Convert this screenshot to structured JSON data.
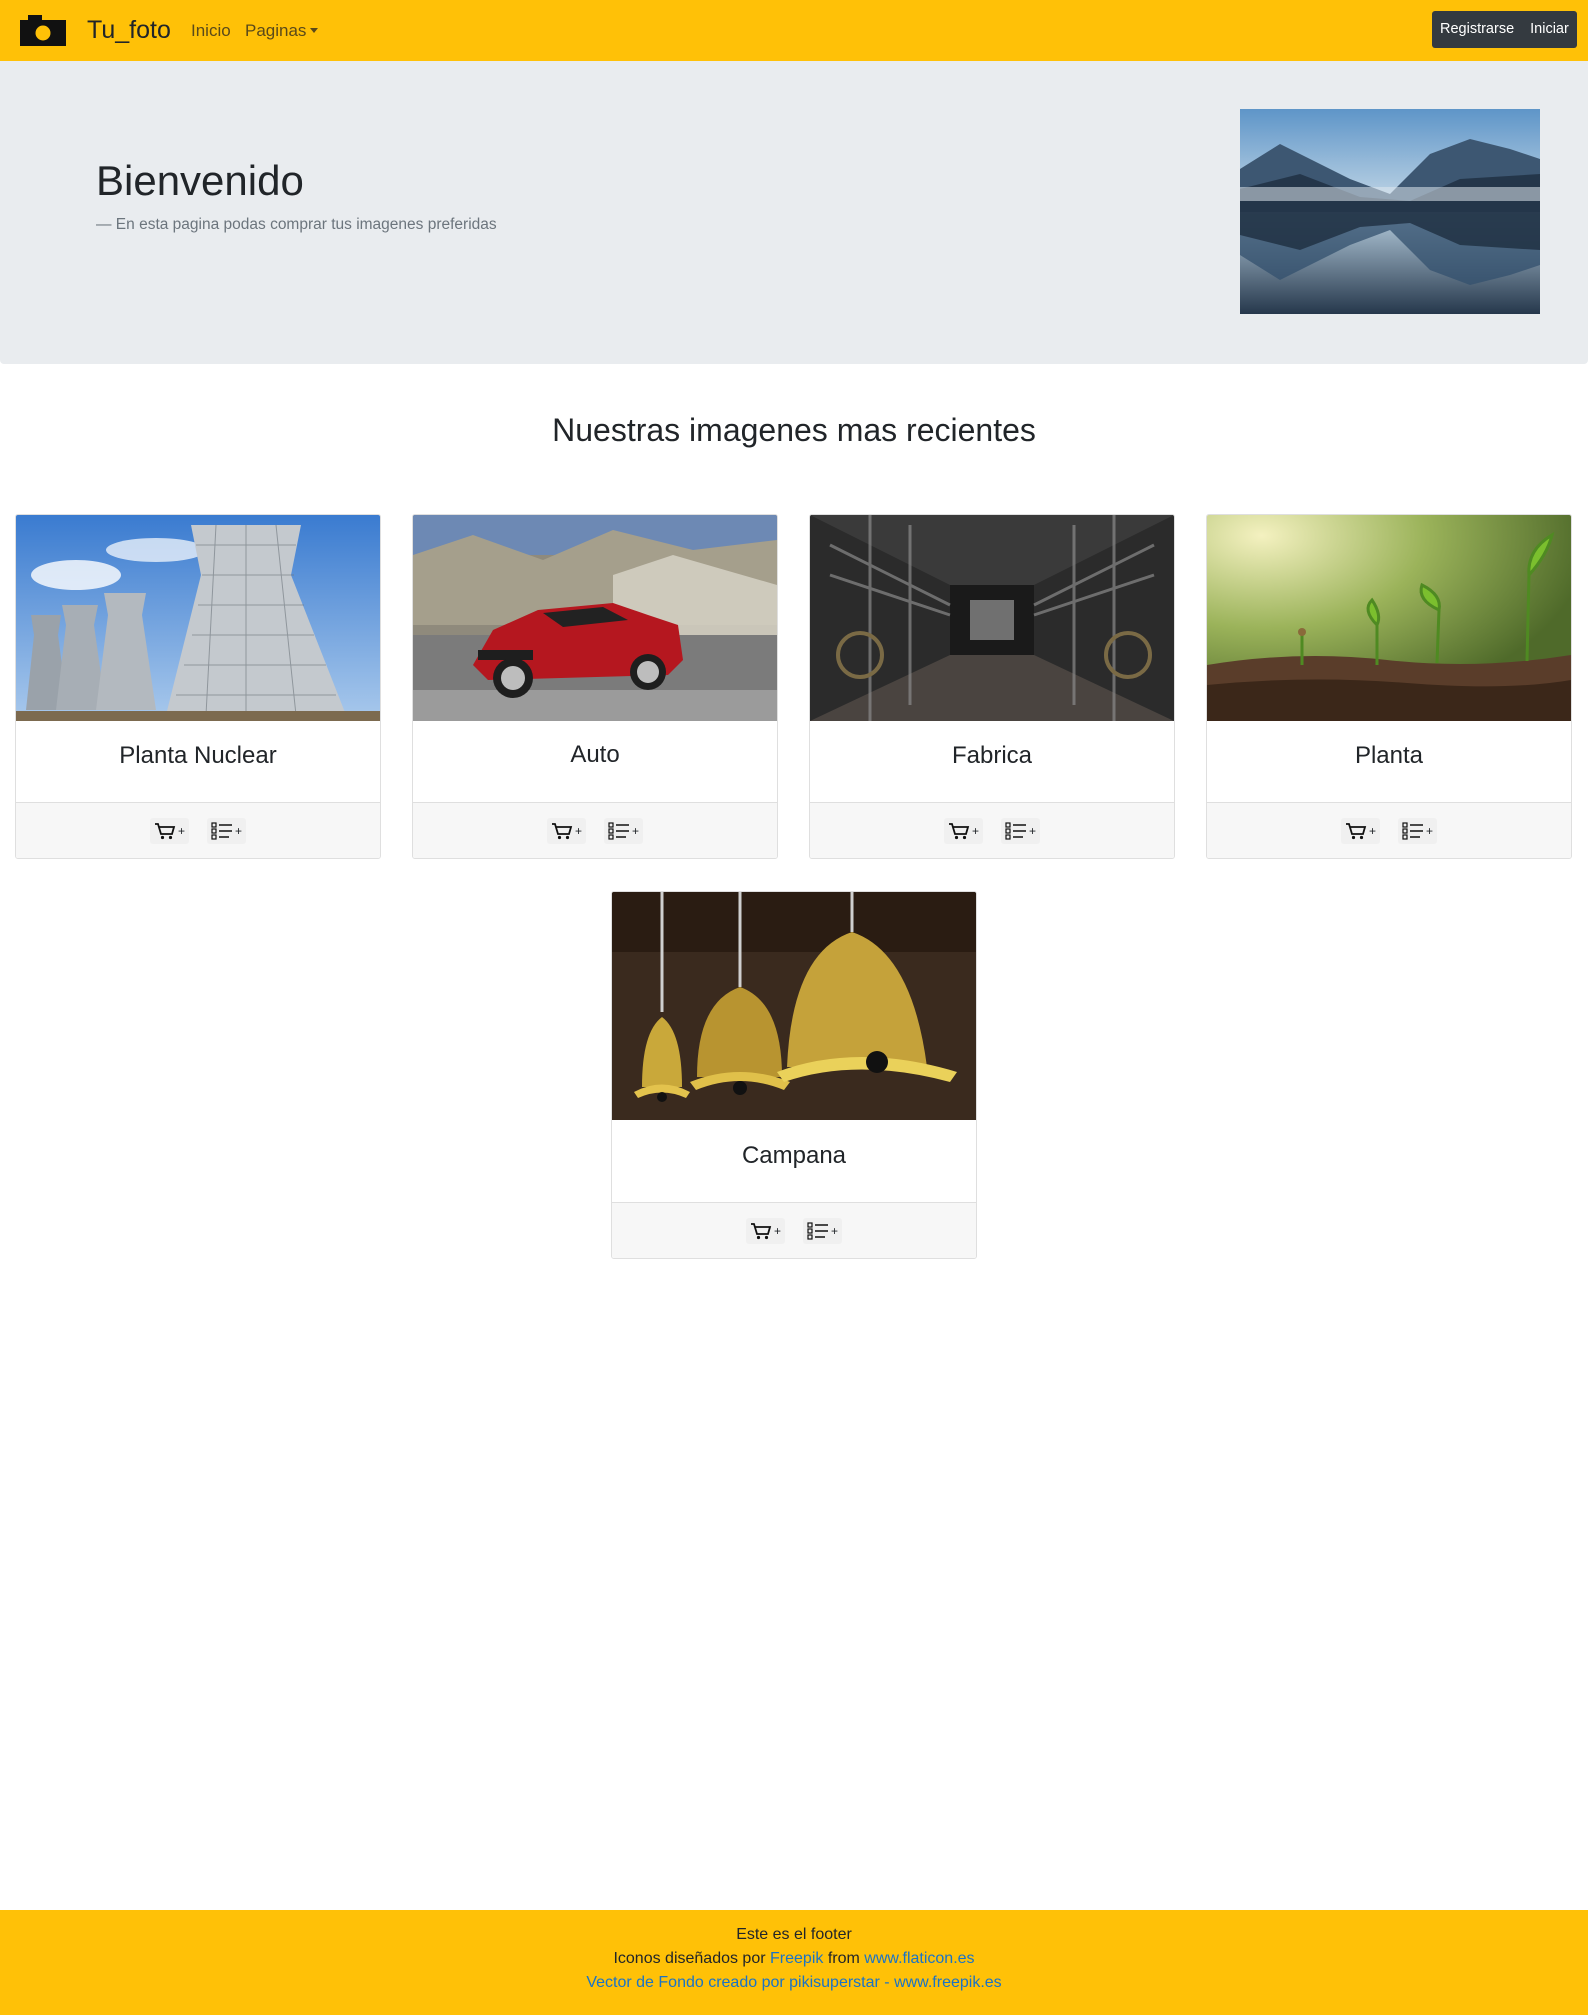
{
  "colors": {
    "navbar": "#ffc107",
    "jumbotron": "#e9ecef",
    "button_dark": "#343a40",
    "link": "#1a73c7"
  },
  "navbar": {
    "logo_icon": "camera-icon",
    "brand": "Tu_foto",
    "links": {
      "inicio": "Inicio",
      "paginas": "Paginas"
    },
    "buttons": {
      "register": "Registrarse",
      "login": "Iniciar"
    }
  },
  "jumbotron": {
    "title": "Bienvenido",
    "subtitle": "— En esta pagina podas comprar tus imagenes preferidas",
    "image": "mountain-lake-photo"
  },
  "section": {
    "title": "Nuestras imagenes mas recientes"
  },
  "cards": [
    {
      "title": "Planta Nuclear",
      "image": "cooling-towers-photo",
      "cart_label": "+",
      "list_label": "+"
    },
    {
      "title": "Auto",
      "image": "red-car-photo",
      "cart_label": "+",
      "list_label": "+"
    },
    {
      "title": "Fabrica",
      "image": "factory-photo",
      "cart_label": "+",
      "list_label": "+"
    },
    {
      "title": "Planta",
      "image": "sprouts-photo",
      "cart_label": "+",
      "list_label": "+"
    },
    {
      "title": "Campana",
      "image": "bells-photo",
      "cart_label": "+",
      "list_label": "+"
    }
  ],
  "footer": {
    "line1": "Este es el footer",
    "line2_prefix": "Iconos diseñados por",
    "line2_link1": "Freepik",
    "line2_mid": "from",
    "line2_link2": "www.flaticon.es",
    "line3": "Vector de Fondo creado por pikisuperstar - www.freepik.es"
  }
}
